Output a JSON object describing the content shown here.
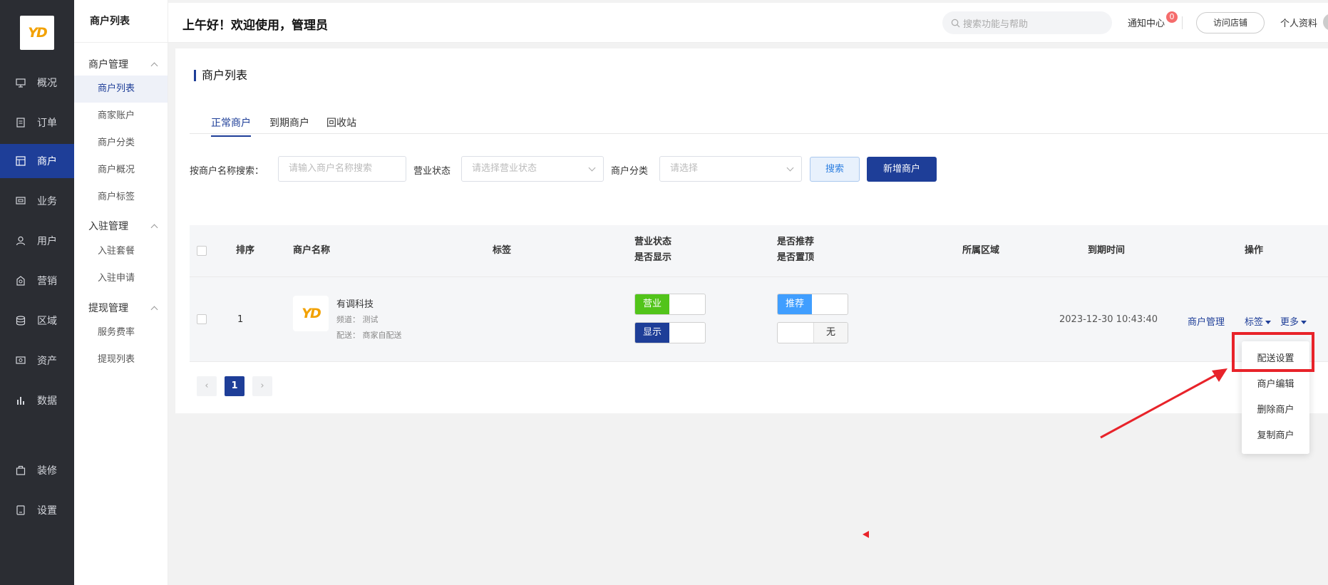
{
  "sidebar": {
    "logo": "YD",
    "items": [
      {
        "label": "概况",
        "icon": "display-icon"
      },
      {
        "label": "订单",
        "icon": "document-icon"
      },
      {
        "label": "商户",
        "icon": "store-icon"
      },
      {
        "label": "业务",
        "icon": "business-icon"
      },
      {
        "label": "用户",
        "icon": "user-icon"
      },
      {
        "label": "营销",
        "icon": "marketing-icon"
      },
      {
        "label": "区域",
        "icon": "region-icon"
      },
      {
        "label": "资产",
        "icon": "asset-icon"
      },
      {
        "label": "数据",
        "icon": "chart-icon"
      },
      {
        "label": "装修",
        "icon": "decoration-icon"
      },
      {
        "label": "设置",
        "icon": "settings-icon"
      }
    ],
    "active": "商户"
  },
  "subnav": {
    "title": "商户列表",
    "groups": [
      {
        "title": "商户管理",
        "items": [
          "商户列表",
          "商家账户",
          "商户分类",
          "商户概况",
          "商户标签"
        ]
      },
      {
        "title": "入驻管理",
        "items": [
          "入驻套餐",
          "入驻申请"
        ]
      },
      {
        "title": "提现管理",
        "items": [
          "服务费率",
          "提现列表"
        ]
      }
    ],
    "active": "商户列表"
  },
  "header": {
    "greeting": "上午好！欢迎使用，管理员",
    "search_placeholder": "搜索功能与帮助",
    "notice_label": "通知中心",
    "notice_count": "0",
    "visit_store": "访问店铺",
    "profile": "个人资料"
  },
  "page": {
    "title": "商户列表",
    "tabs": [
      "正常商户",
      "到期商户",
      "回收站"
    ],
    "active_tab": "正常商户"
  },
  "filters": {
    "name_label": "按商户名称搜索：",
    "name_placeholder": "请输入商户名称搜索",
    "status_label": "营业状态",
    "status_placeholder": "请选择营业状态",
    "category_label": "商户分类",
    "category_placeholder": "请选择",
    "search_btn": "搜索",
    "add_btn": "新增商户"
  },
  "table": {
    "headers": {
      "sort": "排序",
      "name": "商户名称",
      "tag": "标签",
      "status_line1": "营业状态",
      "status_line2": "是否显示",
      "rec_line1": "是否推荐",
      "rec_line2": "是否置顶",
      "area": "所属区域",
      "expire": "到期时间",
      "ops": "操作"
    },
    "rows": [
      {
        "sort": "1",
        "logo": "YD",
        "name": "有调科技",
        "channel": "频道： 测试",
        "delivery": "配送： 商家自配送",
        "business_switch": "营业",
        "display_switch": "显示",
        "recommend_switch": "推荐",
        "top_switch": "无",
        "expire": "2023-12-30 10:43:40",
        "op_manage": "商户管理",
        "op_tag": "标签",
        "op_more": "更多"
      }
    ]
  },
  "pagination": {
    "current": "1",
    "prev": "‹",
    "next": "›"
  },
  "dropdown": {
    "items": [
      "配送设置",
      "商户编辑",
      "删除商户",
      "复制商户"
    ]
  },
  "colors": {
    "primary": "#1e3e98",
    "green": "#52c41a",
    "blue": "#409eff",
    "annotation": "#e8232a"
  }
}
